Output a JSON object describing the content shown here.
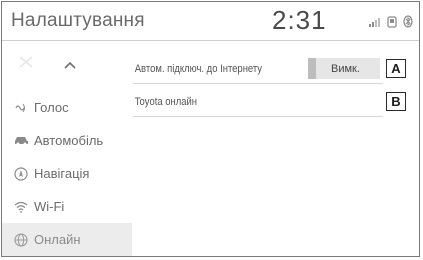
{
  "header": {
    "title": "Налаштування",
    "clock": "2:31"
  },
  "status_icons": [
    "signal-icon",
    "phone-icon",
    "bluetooth-icon"
  ],
  "sidebar": {
    "scroll_up_icon": "chevron-up-icon",
    "items": [
      {
        "label": "Голос",
        "icon": "voice-icon",
        "active": false
      },
      {
        "label": "Автомобіль",
        "icon": "car-icon",
        "active": false
      },
      {
        "label": "Навігація",
        "icon": "navigation-icon",
        "active": false
      },
      {
        "label": "Wi-Fi",
        "icon": "wifi-icon",
        "active": false
      },
      {
        "label": "Онлайн",
        "icon": "globe-icon",
        "active": true
      }
    ]
  },
  "main": {
    "rows": [
      {
        "label": "Автом. підключ. до Інтернету",
        "toggle_value": "Вимк.",
        "callout": "A"
      },
      {
        "label": "Toyota онлайн",
        "callout": "B"
      }
    ]
  },
  "colors": {
    "border": "#7a7a7a",
    "active_bg": "#ececec",
    "toggle_bg": "#e6e6e6"
  }
}
